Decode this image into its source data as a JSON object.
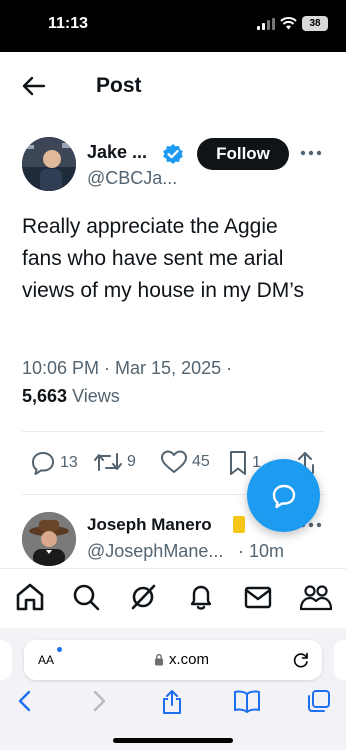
{
  "status": {
    "time": "11:13",
    "battery": "38"
  },
  "header": {
    "title": "Post"
  },
  "tweet": {
    "author_name": "Jake ...",
    "author_handle": "@CBCJa...",
    "follow_label": "Follow",
    "text": "Really appreciate the Aggie fans who have sent me arial views of my house in my DM’s",
    "timestamp": "10:06 PM · Mar 15, 2025 ·",
    "views_count": "5,663",
    "views_label": "Views",
    "replies": "13",
    "reposts": "9",
    "likes": "45",
    "bookmarks": "1"
  },
  "reply": {
    "author_name": "Joseph Manero",
    "author_handle": "@JosephMane...",
    "age": "· 10m"
  },
  "browser": {
    "reader_label": "AA",
    "url": "x.com"
  },
  "colors": {
    "accent": "#1d9bf0",
    "verified": "#1d9bf0",
    "text_primary": "#0f1419",
    "text_secondary": "#536471",
    "safari_blue": "#1d6ff2"
  },
  "icons": [
    "back-arrow-icon",
    "verified-badge-icon",
    "more-icon",
    "reply-icon",
    "repost-icon",
    "like-icon",
    "bookmark-icon",
    "share-icon",
    "compose-reply-icon",
    "home-icon",
    "search-icon",
    "grok-icon",
    "notifications-icon",
    "messages-icon",
    "communities-icon",
    "lock-icon",
    "reload-icon",
    "safari-back-icon",
    "safari-forward-icon",
    "safari-share-icon",
    "safari-bookmarks-icon",
    "safari-tabs-icon"
  ]
}
